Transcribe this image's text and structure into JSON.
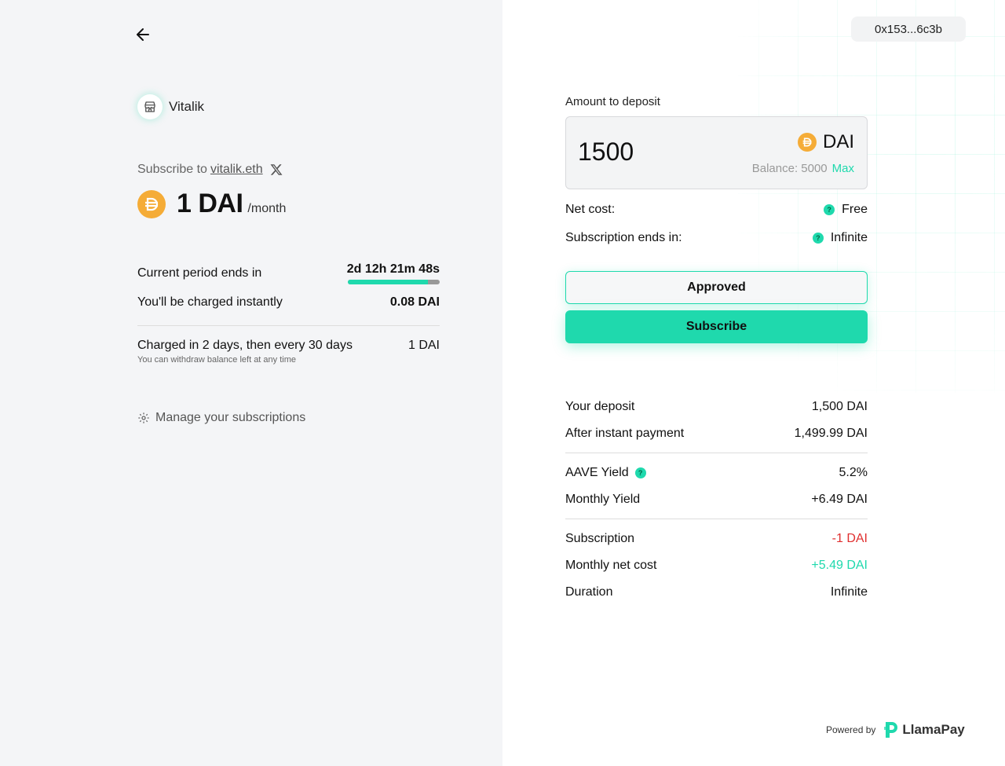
{
  "left": {
    "back_label": "Back",
    "creator": {
      "name": "Vitalik"
    },
    "subscribe_prefix": "Subscribe to",
    "subscribe_handle": "vitalik.eth",
    "price": {
      "amount": "1 DAI",
      "period": "/month"
    },
    "current_period": {
      "label": "Current period ends in",
      "value": "2d 12h 21m 48s",
      "progress_fraction": 0.87
    },
    "charged_instantly": {
      "label": "You'll be charged instantly",
      "value": "0.08 DAI"
    },
    "charged_recurring": {
      "label": "Charged in 2 days, then every 30 days",
      "value": "1 DAI",
      "note": "You can withdraw balance left at any time"
    },
    "manage": {
      "label": "Manage your subscriptions"
    }
  },
  "right": {
    "wallet": "0x153...6c3b",
    "amount_label": "Amount to deposit",
    "amount_value": "1500",
    "token": "DAI",
    "balance": "Balance: 5000",
    "max": "Max",
    "net_cost": {
      "label": "Net cost:",
      "value": "Free"
    },
    "ends_in": {
      "label": "Subscription ends in:",
      "value": "Infinite"
    },
    "approved_btn": "Approved",
    "subscribe_btn": "Subscribe",
    "summary": {
      "deposit": {
        "label": "Your deposit",
        "value": "1,500 DAI"
      },
      "after_payment": {
        "label": "After instant payment",
        "value": "1,499.99 DAI"
      },
      "aave_yield": {
        "label": "AAVE Yield",
        "value": "5.2%"
      },
      "monthly_yield": {
        "label": "Monthly Yield",
        "value": "+6.49 DAI"
      },
      "subscription": {
        "label": "Subscription",
        "value": "-1 DAI"
      },
      "monthly_net": {
        "label": "Monthly net cost",
        "value": "+5.49 DAI"
      },
      "duration": {
        "label": "Duration",
        "value": "Infinite"
      }
    },
    "powered_by": "Powered by",
    "brand": "LlamaPay"
  },
  "colors": {
    "accent": "#1fd9ad",
    "dai": "#f5ac37",
    "negative": "#e03030"
  }
}
